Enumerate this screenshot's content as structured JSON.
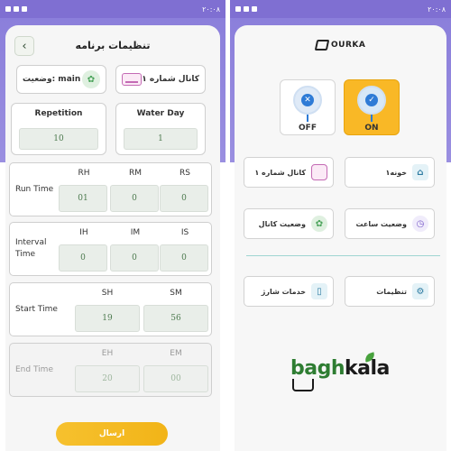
{
  "status_bar": {
    "left": "۲۰:۰۸",
    "right": "۲۰:۰۸"
  },
  "settings_screen": {
    "title": "تنظیمات برنامه",
    "back_icon": "chevron-left-icon",
    "status_label": "وضعیت: main",
    "channel_label": "کانال شماره ۱",
    "repetition": {
      "label": "Repetition",
      "value": "10"
    },
    "water_day": {
      "label": "Water Day",
      "value": "1"
    },
    "run_time": {
      "label": "Run Time",
      "cols": [
        "RH",
        "RM",
        "RS"
      ],
      "values": [
        "01",
        "0",
        "0"
      ]
    },
    "interval_time": {
      "label": "Interval Time",
      "cols": [
        "IH",
        "IM",
        "IS"
      ],
      "values": [
        "0",
        "0",
        "0"
      ]
    },
    "start_time": {
      "label": "Start Time",
      "cols": [
        "SH",
        "SM"
      ],
      "values": [
        "19",
        "56"
      ]
    },
    "end_time": {
      "label": "End Time",
      "cols": [
        "EH",
        "EM"
      ],
      "values": [
        "20",
        "00"
      ]
    },
    "send_label": "ارسال"
  },
  "home_screen": {
    "logo_text": "OURKA",
    "off_label": "OFF",
    "on_label": "ON",
    "tiles": [
      {
        "label": "کانال شماره ۱",
        "icon": "air-conditioner-icon"
      },
      {
        "label": "خونه۱",
        "icon": "house-icon"
      },
      {
        "label": "وضعیت کانال",
        "icon": "plant-icon"
      },
      {
        "label": "وضعیت ساعت",
        "icon": "clock-icon"
      },
      {
        "label": "خدمات شارژ",
        "icon": "phone-charge-icon"
      },
      {
        "label": "تنظیمات",
        "icon": "gear-icon"
      }
    ]
  },
  "watermark": {
    "brand": "baghkala",
    "brand_part1": "bagh",
    "brand_part2": "kala"
  },
  "colors": {
    "purple": "#8b7fdb",
    "yellow": "#f9b826",
    "green": "#2e7d32",
    "blue": "#2e7bd6"
  }
}
